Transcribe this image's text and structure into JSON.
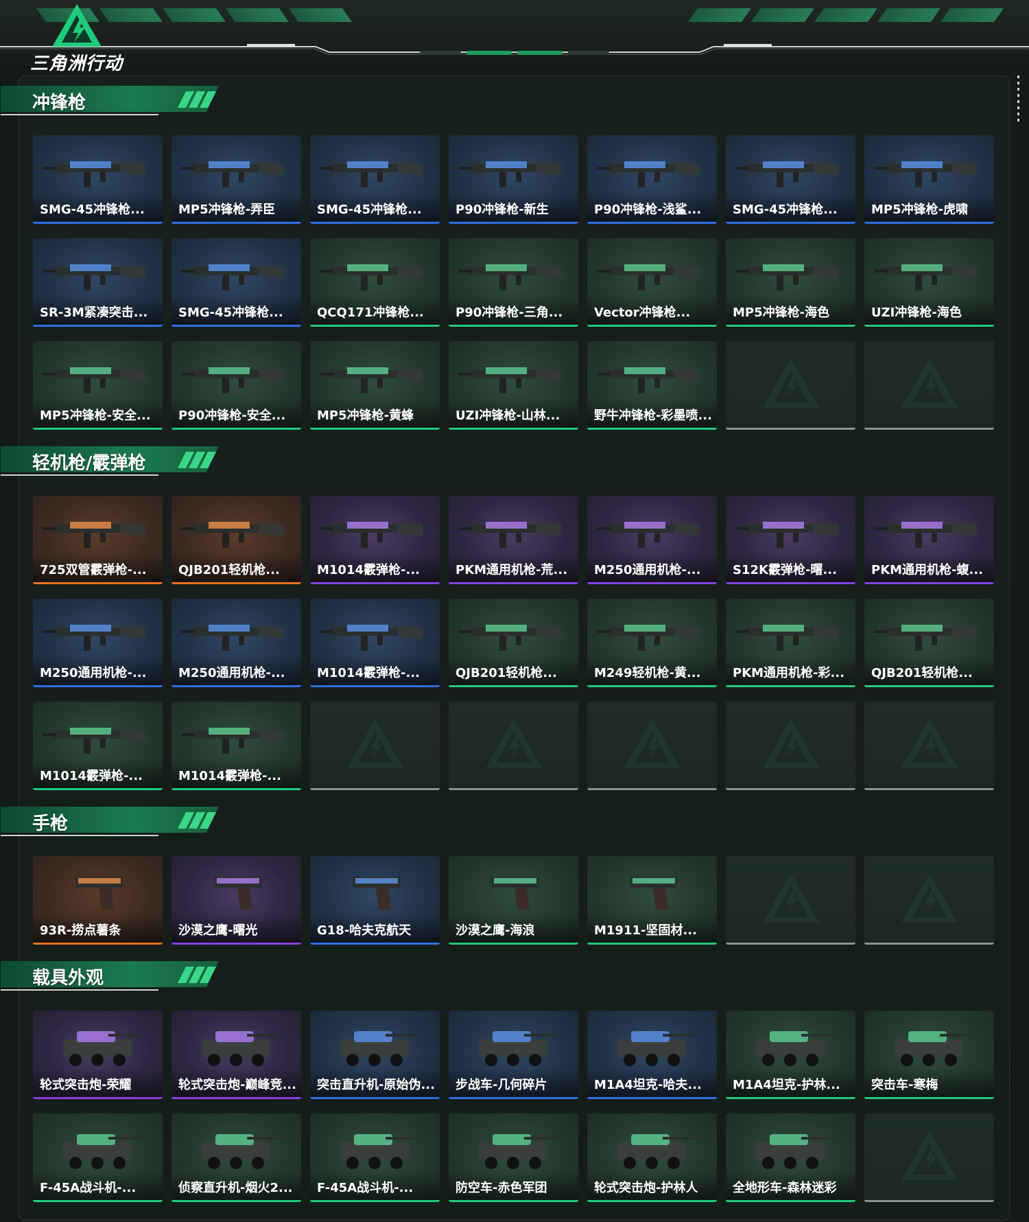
{
  "header": {
    "logo_text": "三角洲行动",
    "colors": {
      "accent": "#1fcb7c",
      "banner": "#1c5b3d"
    }
  },
  "sections": [
    {
      "title": "冲锋枪",
      "items": [
        {
          "name": "SMG-45冲锋枪...",
          "rarity": "blue"
        },
        {
          "name": "MP5冲锋枪-弄臣",
          "rarity": "blue"
        },
        {
          "name": "SMG-45冲锋枪...",
          "rarity": "blue"
        },
        {
          "name": "P90冲锋枪-新生",
          "rarity": "blue"
        },
        {
          "name": "P90冲锋枪-浅鲨...",
          "rarity": "blue"
        },
        {
          "name": "SMG-45冲锋枪...",
          "rarity": "blue"
        },
        {
          "name": "MP5冲锋枪-虎啸",
          "rarity": "blue"
        },
        {
          "name": "SR-3M紧凑突击...",
          "rarity": "blue"
        },
        {
          "name": "SMG-45冲锋枪...",
          "rarity": "blue"
        },
        {
          "name": "QCQ171冲锋枪...",
          "rarity": "green"
        },
        {
          "name": "P90冲锋枪-三角...",
          "rarity": "green"
        },
        {
          "name": "Vector冲锋枪...",
          "rarity": "green"
        },
        {
          "name": "MP5冲锋枪-海色",
          "rarity": "green"
        },
        {
          "name": "UZI冲锋枪-海色",
          "rarity": "green"
        },
        {
          "name": "MP5冲锋枪-安全...",
          "rarity": "green"
        },
        {
          "name": "P90冲锋枪-安全...",
          "rarity": "green"
        },
        {
          "name": "MP5冲锋枪-黄蜂",
          "rarity": "green"
        },
        {
          "name": "UZI冲锋枪-山林...",
          "rarity": "green"
        },
        {
          "name": "野牛冲锋枪-彩墨喷...",
          "rarity": "green"
        },
        {
          "name": "",
          "rarity": "empty"
        },
        {
          "name": "",
          "rarity": "empty"
        }
      ]
    },
    {
      "title": "轻机枪/霰弹枪",
      "items": [
        {
          "name": "725双管霰弹枪-...",
          "rarity": "orange"
        },
        {
          "name": "QJB201轻机枪...",
          "rarity": "orange"
        },
        {
          "name": "M1014霰弹枪-...",
          "rarity": "purple"
        },
        {
          "name": "PKM通用机枪-荒...",
          "rarity": "purple"
        },
        {
          "name": "M250通用机枪-...",
          "rarity": "purple"
        },
        {
          "name": "S12K霰弹枪-曙...",
          "rarity": "purple"
        },
        {
          "name": "PKM通用机枪-蝮...",
          "rarity": "purple"
        },
        {
          "name": "M250通用机枪-...",
          "rarity": "blue"
        },
        {
          "name": "M250通用机枪-...",
          "rarity": "blue"
        },
        {
          "name": "M1014霰弹枪-...",
          "rarity": "blue"
        },
        {
          "name": "QJB201轻机枪...",
          "rarity": "green"
        },
        {
          "name": "M249轻机枪-黄...",
          "rarity": "green"
        },
        {
          "name": "PKM通用机枪-彩...",
          "rarity": "green"
        },
        {
          "name": "QJB201轻机枪...",
          "rarity": "green"
        },
        {
          "name": "M1014霰弹枪-...",
          "rarity": "green"
        },
        {
          "name": "M1014霰弹枪-...",
          "rarity": "green"
        },
        {
          "name": "",
          "rarity": "empty"
        },
        {
          "name": "",
          "rarity": "empty"
        },
        {
          "name": "",
          "rarity": "empty"
        },
        {
          "name": "",
          "rarity": "empty"
        },
        {
          "name": "",
          "rarity": "empty"
        }
      ]
    },
    {
      "title": "手枪",
      "items": [
        {
          "name": "93R-捞点薯条",
          "rarity": "orange"
        },
        {
          "name": "沙漠之鹰-曙光",
          "rarity": "purple"
        },
        {
          "name": "G18-哈夫克航天",
          "rarity": "blue"
        },
        {
          "name": "沙漠之鹰-海浪",
          "rarity": "green"
        },
        {
          "name": "M1911-坚固材...",
          "rarity": "green"
        },
        {
          "name": "",
          "rarity": "empty"
        },
        {
          "name": "",
          "rarity": "empty"
        }
      ]
    },
    {
      "title": "载具外观",
      "items": [
        {
          "name": "轮式突击炮-荣耀",
          "rarity": "purple"
        },
        {
          "name": "轮式突击炮-巅峰竞...",
          "rarity": "purple"
        },
        {
          "name": "突击直升机-原始伪...",
          "rarity": "blue"
        },
        {
          "name": "步战车-几何碎片",
          "rarity": "blue"
        },
        {
          "name": "M1A4坦克-哈夫...",
          "rarity": "blue"
        },
        {
          "name": "M1A4坦克-护林...",
          "rarity": "green"
        },
        {
          "name": "突击车-寒梅",
          "rarity": "green"
        },
        {
          "name": "F-45A战斗机-...",
          "rarity": "green"
        },
        {
          "name": "侦察直升机-烟火2...",
          "rarity": "green"
        },
        {
          "name": "F-45A战斗机-...",
          "rarity": "green"
        },
        {
          "name": "防空车-赤色军团",
          "rarity": "green"
        },
        {
          "name": "轮式突击炮-护林人",
          "rarity": "green"
        },
        {
          "name": "全地形车-森林迷彩",
          "rarity": "green"
        },
        {
          "name": "",
          "rarity": "empty"
        }
      ]
    }
  ]
}
